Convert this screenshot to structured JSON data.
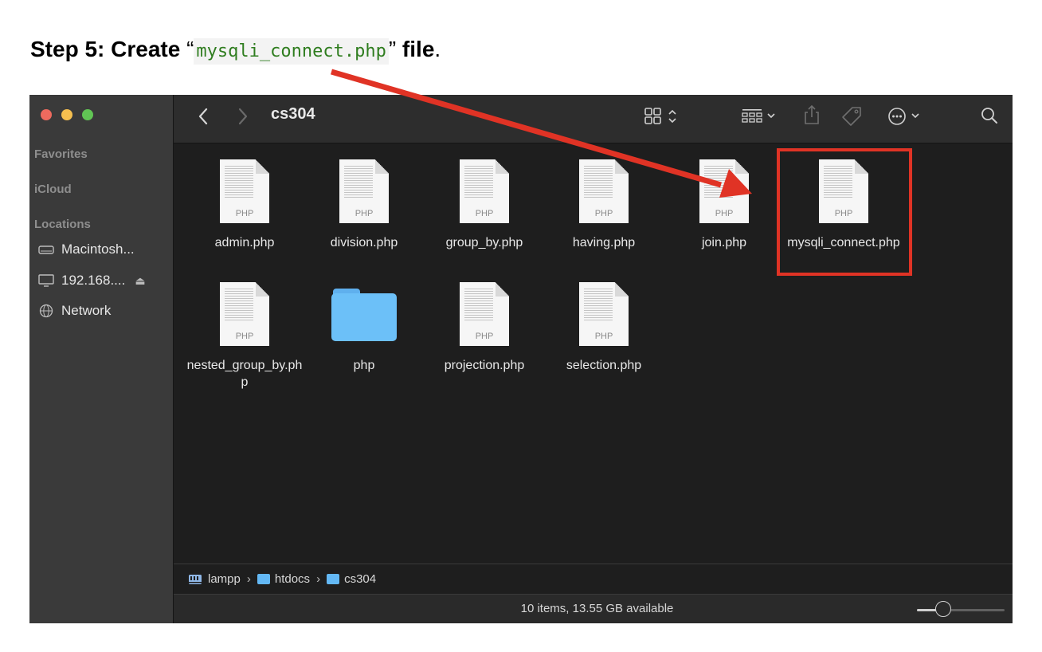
{
  "heading": {
    "prefix": "Step 5: Create ",
    "open_quote": "“",
    "filename": "mysqli_connect.php",
    "close_quote": "”",
    "suffix": " file",
    "period": "."
  },
  "window": {
    "title": "cs304",
    "sidebar": {
      "sections": [
        "Favorites",
        "iCloud",
        "Locations"
      ],
      "locations": [
        {
          "label": "Macintosh...",
          "icon": "hard-drive-icon"
        },
        {
          "label": "192.168....",
          "icon": "computer-icon"
        },
        {
          "label": "Network",
          "icon": "globe-icon"
        }
      ]
    },
    "files": [
      {
        "name": "admin.php",
        "kind": "php-file",
        "badge": "PHP"
      },
      {
        "name": "division.php",
        "kind": "php-file",
        "badge": "PHP"
      },
      {
        "name": "group_by.php",
        "kind": "php-file",
        "badge": "PHP"
      },
      {
        "name": "having.php",
        "kind": "php-file",
        "badge": "PHP"
      },
      {
        "name": "join.php",
        "kind": "php-file",
        "badge": "PHP"
      },
      {
        "name": "mysqli_connect.php",
        "kind": "php-file",
        "badge": "PHP"
      },
      {
        "name": "nested_group_by.php",
        "kind": "php-file",
        "badge": "PHP"
      },
      {
        "name": "php",
        "kind": "folder",
        "badge": ""
      },
      {
        "name": "projection.php",
        "kind": "php-file",
        "badge": "PHP"
      },
      {
        "name": "selection.php",
        "kind": "php-file",
        "badge": "PHP"
      }
    ],
    "path": [
      "lampp",
      "htdocs",
      "cs304"
    ],
    "status": "10 items, 13.55 GB available",
    "icon_size_slider": 0.3
  },
  "colors": {
    "annotation_red": "#e03325",
    "folder_blue": "#6cc0f8",
    "code_green": "#2f7d1f"
  }
}
